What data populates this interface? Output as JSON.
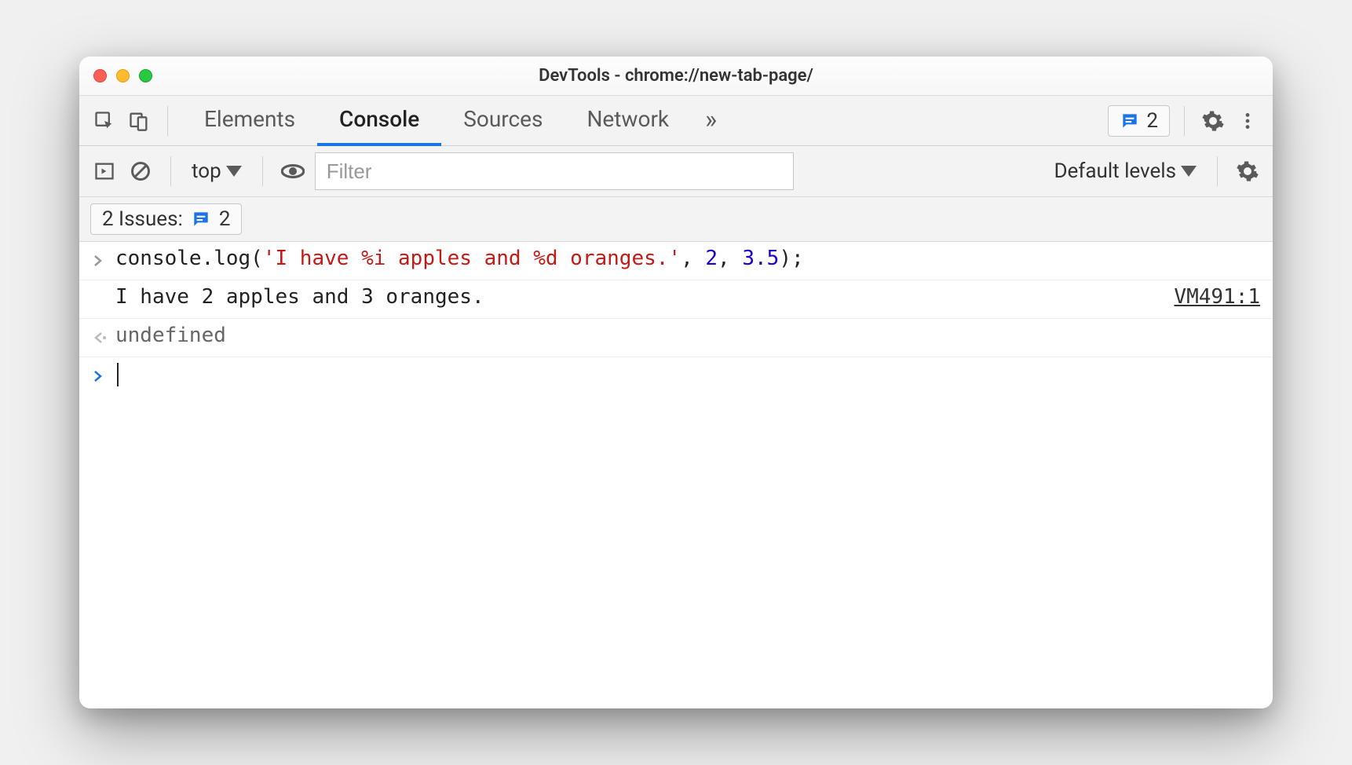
{
  "window": {
    "title": "DevTools - chrome://new-tab-page/"
  },
  "tabs": {
    "elements": "Elements",
    "console": "Console",
    "sources": "Sources",
    "network": "Network"
  },
  "issues_badge": {
    "count": "2"
  },
  "toolbar": {
    "context": "top",
    "filter_placeholder": "Filter",
    "levels": "Default levels"
  },
  "issues_bar": {
    "label": "2 Issues:",
    "count": "2"
  },
  "console": {
    "input_prefix": "console.log(",
    "input_string": "'I have %i apples and %d oranges.'",
    "input_sep1": ", ",
    "input_arg1": "2",
    "input_sep2": ", ",
    "input_arg2": "3.5",
    "input_suffix": ");",
    "output": "I have 2 apples and 3 oranges.",
    "source": "VM491:1",
    "return": "undefined"
  }
}
